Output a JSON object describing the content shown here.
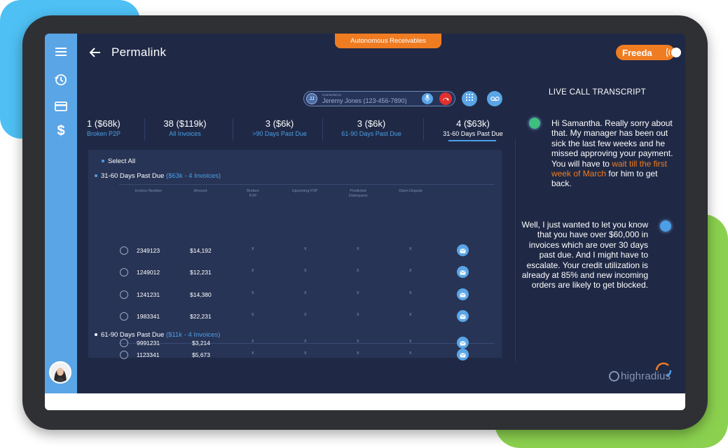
{
  "app_tab": "Autonomous Receivables",
  "header": {
    "title": "Permalink"
  },
  "assistant": {
    "name": "Freeda"
  },
  "call": {
    "connected_label": "Connected to",
    "avatar_initials": "JJ",
    "caller": "Jeremy Jones (123-456-7890)"
  },
  "stats": [
    {
      "value": "1 ($68k)",
      "label": "Broken P2P"
    },
    {
      "value": "38 ($119k)",
      "label": "All Invoices"
    },
    {
      "value": "3 ($6k)",
      "label": ">90 Days Past Due"
    },
    {
      "value": "3 ($6k)",
      "label": "61-90 Days Past Due"
    },
    {
      "value": "4 ($63k)",
      "label": "31-60 Days Past Due"
    }
  ],
  "invoices": {
    "select_all": "Select All",
    "columns": [
      "Invoice Number",
      "Amount",
      "Broken P2P",
      "Upcoming P2P",
      "Predicted Delinquent",
      "Open Dispute"
    ],
    "groups": [
      {
        "title": "31-60 Days Past Due",
        "summary": "($63k - 4 Invoices)",
        "rows": [
          {
            "number": "2349123",
            "amount": "$14,192",
            "broken": "x",
            "upcoming": "x",
            "predicted": "x",
            "dispute": "x"
          },
          {
            "number": "1249012",
            "amount": "$12,231",
            "broken": "x",
            "upcoming": "x",
            "predicted": "x",
            "dispute": "x"
          },
          {
            "number": "1241231",
            "amount": "$14,380",
            "broken": "x",
            "upcoming": "x",
            "predicted": "x",
            "dispute": "x"
          },
          {
            "number": "1983341",
            "amount": "$22,231",
            "broken": "x",
            "upcoming": "x",
            "predicted": "x",
            "dispute": "x"
          }
        ]
      },
      {
        "title": "61-90 Days Past Due",
        "summary": "($11k - 4 Invoices)",
        "rows": [
          {
            "number": "1123341",
            "amount": "$5,673",
            "broken": "x",
            "upcoming": "x",
            "predicted": "x",
            "dispute": "x"
          },
          {
            "number": "9991231",
            "amount": "$3,214",
            "broken": "x",
            "upcoming": "x",
            "predicted": "x",
            "dispute": "x"
          }
        ]
      }
    ]
  },
  "transcript": {
    "title": "LIVE CALL TRANSCRIPT",
    "messages": [
      {
        "speaker_color": "#3fbf7f",
        "text_before": "Hi Samantha. Really sorry about that. My manager has been out sick the last few weeks and he missed approving your payment. You will have to ",
        "highlight": "wait till the first week of March",
        "text_after": " for him to get back."
      },
      {
        "speaker_color": "#4c9fe6",
        "text": "Well, I just wanted to let you know that you have over $60,000 in invoices which are over 30 days past due. And I might have to escalate. Your credit utilization is already at 85% and new incoming orders are likely to get blocked."
      }
    ]
  },
  "brand": {
    "logo_text": "highradius"
  },
  "colors": {
    "accent": "#f07c22",
    "primary": "#5aa5e6",
    "link": "#4c9fe6",
    "background": "#1f2945",
    "danger": "#e0312e"
  }
}
